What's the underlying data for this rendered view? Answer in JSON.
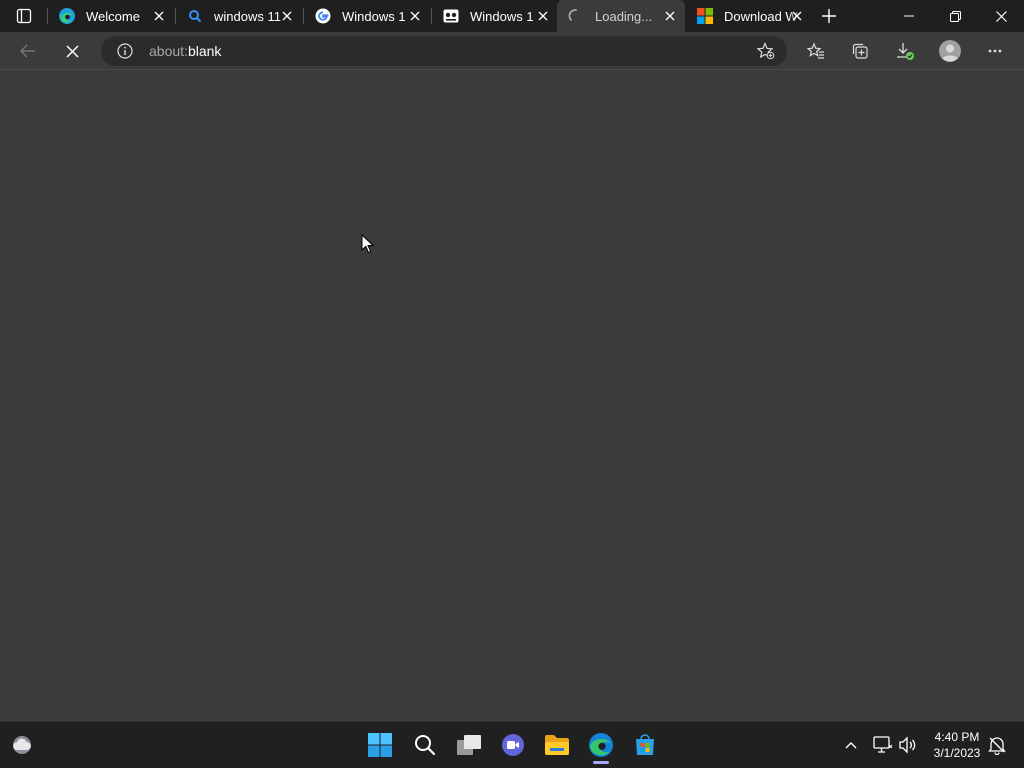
{
  "browser": {
    "tabs": [
      {
        "title": "Welcome",
        "favicon": "edge-logo-icon",
        "active": false
      },
      {
        "title": "windows 11",
        "favicon": "search-icon",
        "active": false
      },
      {
        "title": "Windows 1",
        "favicon": "google-g-icon",
        "active": false
      },
      {
        "title": "Windows 1",
        "favicon": "site-logo-icon",
        "active": false
      },
      {
        "title": "Loading...",
        "favicon": "loading-spinner-icon",
        "active": true
      },
      {
        "title": "Download W",
        "favicon": "microsoft-logo-icon",
        "active": false
      }
    ],
    "address_bar": {
      "prefix": "about:",
      "host": "blank"
    }
  },
  "taskbar": {
    "pinned": [
      "start-icon",
      "search-icon",
      "task-view-icon",
      "teams-chat-icon",
      "file-explorer-icon",
      "edge-icon",
      "microsoft-store-icon"
    ],
    "active_app": "edge-icon",
    "clock": {
      "time": "4:40 PM",
      "date": "3/1/2023"
    }
  },
  "colors": {
    "tabstrip": "#1f1f1f",
    "page_background": "#3b3b3b",
    "address_background": "#2b2b2b",
    "taskbar": "#202020",
    "active_indicator": "#a6a6ff"
  }
}
